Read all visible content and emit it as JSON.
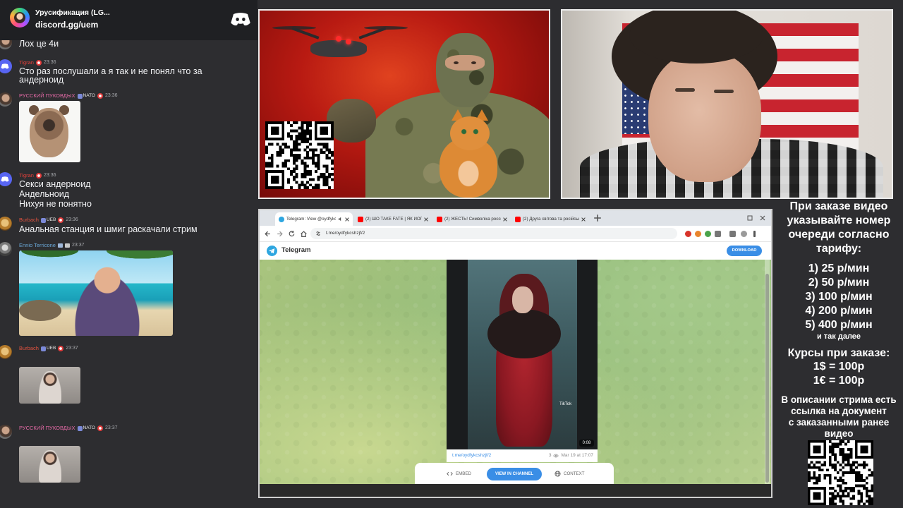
{
  "colors": {
    "background": "#2d2d30",
    "discord_blurple": "#5865f2",
    "telegram_blue": "#3a8ee6",
    "tigran": "#e3413b",
    "russkiy": "#e46aa6",
    "burbach": "#e0523f",
    "ennio": "#6aa8d8"
  },
  "discord": {
    "server_name": "Урусификация (LG...",
    "invite": "discord.gg/uem",
    "server_icon": "server-icon",
    "logo_icon": "discord-logo-icon"
  },
  "chat": {
    "partial_message": "Лох це 4и",
    "messages": [
      {
        "user": "Tigran",
        "time": "23:36",
        "lines": [
          "Сто раз послушали а я так и не понял что за",
          "андерноид"
        ]
      },
      {
        "user": "РУССКИЙ ПУКОВДЫХ",
        "badge": "NATO",
        "time": "23:36"
      },
      {
        "user": "Tigran",
        "time": "23:36",
        "lines": [
          "Секси андерноид",
          "Андельноид",
          "Нихуя не понятно"
        ]
      },
      {
        "user": "Burbach",
        "badge": "UEB",
        "time": "23:36",
        "lines": [
          "Анальная станция и шмиг раскачали стрим"
        ]
      },
      {
        "user": "Ennio Terricone",
        "time": "23:37"
      },
      {
        "user": "Burbach",
        "badge": "UEB",
        "time": "23:37"
      },
      {
        "user": "РУССКИЙ ПУКОВДЫХ",
        "badge": "NATO",
        "time": "23:37"
      }
    ]
  },
  "browser": {
    "tabs": [
      "Telegram: View @oydfykcs",
      "(2) ШО ТАКЕ FATE | ЯК ЙОГО Д",
      "(2) ЖЕСТЬ! Символіка росси",
      "(2) Друга світова та російськ"
    ],
    "url": "t.me/oydfykcshzjf/2"
  },
  "telegram": {
    "brand": "Telegram",
    "download_label": "DOWNLOAD",
    "video": {
      "duration": "0:08",
      "watermark": "TikTok"
    },
    "post": {
      "link": "t.me/oydfykcshzjf/2",
      "views": "3",
      "date": "Mar 19 at 17:07"
    },
    "actions": {
      "embed": "EMBED",
      "view_in_channel": "VIEW IN CHANNEL",
      "context": "CONTEXT"
    }
  },
  "info": {
    "order_instruction": [
      "При заказе видео",
      "указывайте номер",
      "очереди согласно",
      "тарифу:"
    ],
    "tariffs": [
      "1) 25 р/мин",
      "2) 50 р/мин",
      "3) 100 р/мин",
      "4) 200 р/мин",
      "5) 400 р/мин"
    ],
    "tariffs_more": "и так далее",
    "rates_title": "Курсы при заказе:",
    "rates": [
      "1$ = 100р",
      "1€ = 100р"
    ],
    "description_note": [
      "В описании стрима есть",
      "ссылка на документ",
      "с заказанными ранее",
      "видео"
    ]
  }
}
